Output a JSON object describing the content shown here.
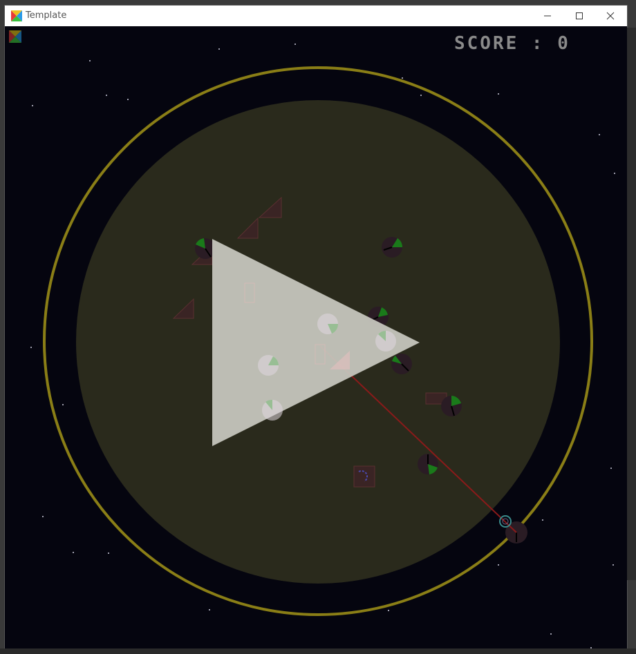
{
  "window": {
    "title": "Template",
    "minimize_icon": "minimize-icon",
    "maximize_icon": "maximize-icon",
    "close_icon": "close-icon"
  },
  "hud": {
    "score_label": "SCORE : 0"
  },
  "colors": {
    "background": "#05050f",
    "orbit_ring": "#8a7e16",
    "planet": "#2a2a1c",
    "play_overlay": "#c8c8c0",
    "laser": "#8b1a1a",
    "hazard": "#3a2424"
  },
  "icons": [
    "app-logo-icon",
    "play-triangle-icon"
  ]
}
